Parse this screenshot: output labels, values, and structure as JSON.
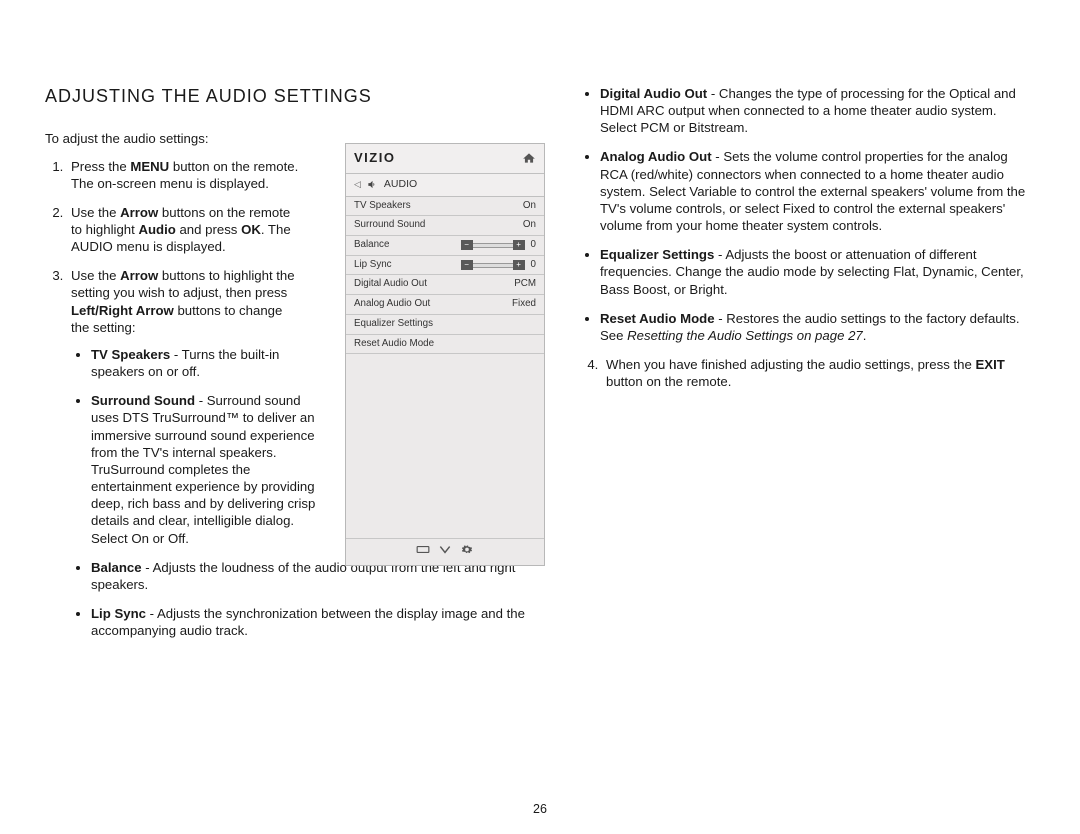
{
  "heading": "ADJUSTING THE AUDIO SETTINGS",
  "intro": "To adjust the audio settings:",
  "steps": {
    "s1": {
      "pre": "Press the ",
      "b1": "MENU",
      "post": " button on the remote. The on-screen menu is displayed."
    },
    "s2": {
      "pre": "Use the ",
      "b1": "Arrow",
      "mid1": " buttons on the remote to highlight ",
      "b2": "Audio",
      "mid2": " and press ",
      "b3": "OK",
      "post": ". The AUDIO menu is displayed."
    },
    "s3": {
      "pre": "Use the ",
      "b1": "Arrow",
      "mid1": " buttons to highlight the setting you wish to adjust, then press ",
      "b2": "Left/Right Arrow",
      "post": " buttons to change the setting:"
    },
    "s4": {
      "pre": "When you have finished adjusting the audio settings, press the ",
      "b1": "EXIT",
      "post": " button on the remote."
    }
  },
  "bullets_left": {
    "tv": {
      "label": "TV Speakers",
      "text": " - Turns the built-in speakers on or off."
    },
    "surround": {
      "label": "Surround Sound",
      "text": " - Surround sound uses DTS TruSurround™ to deliver an immersive surround sound experience from the TV's internal speakers. TruSurround completes the entertainment experience by providing deep, rich bass and by delivering crisp details and clear, intelligible dialog. Select On or Off."
    },
    "balance": {
      "label": "Balance",
      "text": " - Adjusts the loudness of the audio output from the left and right speakers."
    },
    "lipsync": {
      "label": "Lip Sync",
      "text": " - Adjusts the synchronization between the display image and the accompanying audio track."
    }
  },
  "bullets_right": {
    "digital": {
      "label": "Digital Audio Out",
      "text": " - Changes the type of processing for the Optical and HDMI ARC output when connected to a home theater audio system. Select PCM or Bitstream."
    },
    "analog": {
      "label": "Analog Audio Out",
      "text": " - Sets the volume control properties for the analog RCA (red/white) connectors when connected to a home theater audio system. Select Variable to control the external speakers' volume from the TV's volume controls, or select Fixed to control the external speakers' volume from your home theater system controls."
    },
    "eq": {
      "label": "Equalizer Settings",
      "text": " - Adjusts the boost or attenuation of different frequencies. Change the audio mode by selecting Flat, Dynamic, Center, Bass Boost, or Bright."
    },
    "reset": {
      "label": "Reset Audio Mode",
      "text": " - Restores the audio settings to the factory defaults. See ",
      "em": "Resetting the Audio Settings on page 27",
      "post": "."
    }
  },
  "vizio": {
    "logo": "VIZIO",
    "section": "AUDIO",
    "rows": {
      "tv": {
        "label": "TV Speakers",
        "val": "On"
      },
      "surround": {
        "label": "Surround Sound",
        "val": "On"
      },
      "balance": {
        "label": "Balance",
        "val": "0"
      },
      "lipsync": {
        "label": "Lip Sync",
        "val": "0"
      },
      "digital": {
        "label": "Digital Audio Out",
        "val": "PCM"
      },
      "analog": {
        "label": "Analog Audio Out",
        "val": "Fixed"
      },
      "eq": {
        "label": "Equalizer Settings"
      },
      "reset": {
        "label": "Reset Audio Mode"
      }
    }
  },
  "page_number": "26"
}
